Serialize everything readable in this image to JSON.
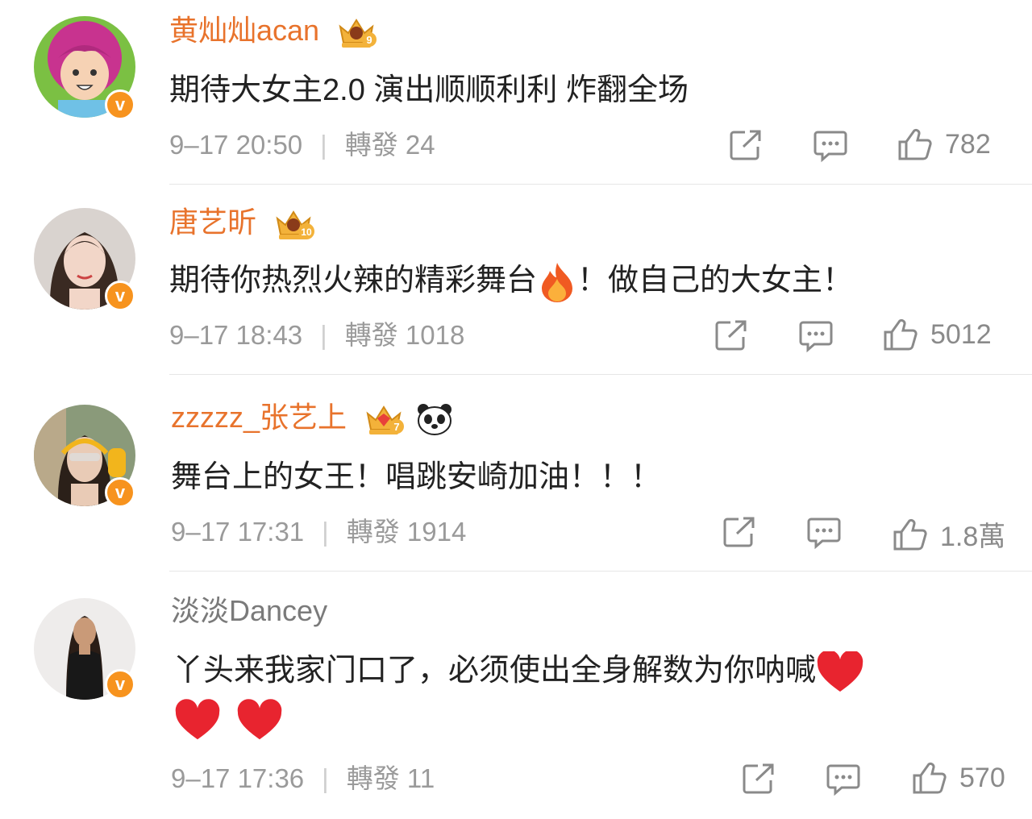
{
  "comments": [
    {
      "username": "黄灿灿acan",
      "crown_level": "9",
      "text": "期待大女主2.0  演出顺顺利利 炸翻全场",
      "time": "9–17 20:50",
      "repost_label": "轉發",
      "repost_count": "24",
      "likes": "782",
      "verified": "v"
    },
    {
      "username": "唐艺昕",
      "crown_level": "10",
      "text_before": "期待你热烈火辣的精彩舞台",
      "text_after": "！做自己的大女主！",
      "emoji": "fire-emoji",
      "time": "9–17 18:43",
      "repost_label": "轉發",
      "repost_count": "1018",
      "likes": "5012",
      "verified": "v"
    },
    {
      "username": "zzzzz_张艺上",
      "crown_level": "7",
      "text": "舞台上的女王！唱跳安崎加油！！！",
      "time": "9–17 17:31",
      "repost_label": "轉發",
      "repost_count": "1914",
      "likes": "1.8萬",
      "verified": "v"
    },
    {
      "username": "淡淡Dancey",
      "text_line1": "丫头来我家门口了，必须使出全身解数为你呐喊",
      "emoji": "red-heart-emoji",
      "time": "9–17 17:36",
      "repost_label": "轉發",
      "repost_count": "11",
      "likes": "570",
      "verified": "v"
    }
  ],
  "colors": {
    "username_orange": "#e8732c",
    "username_gray": "#7a7a7a",
    "meta_gray": "#9a9a9a",
    "verified_badge": "#f7931e",
    "heart_red": "#e8242f"
  }
}
